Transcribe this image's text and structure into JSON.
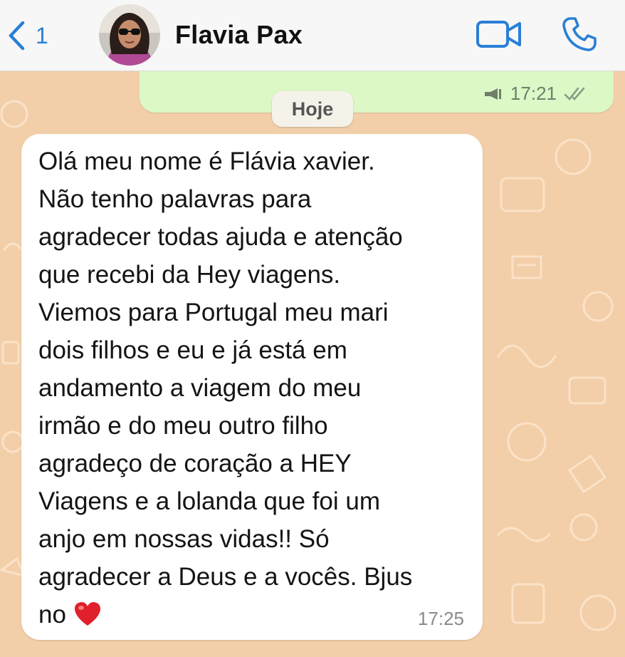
{
  "header": {
    "back_count": "1",
    "contact_name": "Flavia Pax"
  },
  "messages": {
    "outgoing_time": "17:21",
    "day_label": "Hoje",
    "incoming_lines": [
      "Olá meu nome é Flávia xavier.",
      "Não tenho palavras para",
      "agradecer todas ajuda e atenção",
      "que recebi da Hey viagens.",
      "Viemos para Portugal meu mari",
      "dois filhos e eu e já está em",
      "andamento a viagem do meu",
      "irmão e do meu outro filho",
      "agradeço de coração a HEY",
      "Viagens e a lolanda que foi um",
      "anjo em nossas vidas!! Só",
      "agradecer a Deus e a vocês. Bjus",
      "no"
    ],
    "incoming_emoji": "❤️",
    "incoming_time": "17:25"
  },
  "icons": {
    "back": "chevron-left-icon",
    "video": "video-camera-icon",
    "phone": "phone-icon",
    "mic": "megaphone-icon",
    "read": "double-check-icon"
  },
  "colors": {
    "accent": "#2a7fd6",
    "wallpaper": "#f2cfa9",
    "outgoing_bubble": "#dcf8c6",
    "incoming_bubble": "#ffffff",
    "heart": "#e0202b"
  }
}
